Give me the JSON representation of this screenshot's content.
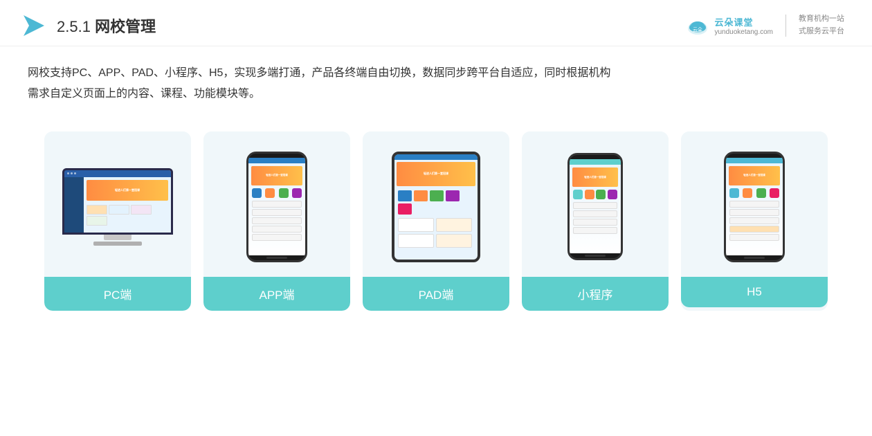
{
  "header": {
    "section_num": "2.5.1",
    "section_name": "网校管理",
    "brand_name": "云朵课堂",
    "brand_url": "yunduoketang.com",
    "brand_slogan_line1": "教育机构一站",
    "brand_slogan_line2": "式服务云平台"
  },
  "description": {
    "line1": "网校支持PC、APP、PAD、小程序、H5，实现多端打通，产品各终端自由切换，数据同步跨平台自适应，同时根据机构",
    "line2": "需求自定义页面上的内容、课程、功能模块等。"
  },
  "cards": [
    {
      "id": "pc",
      "label": "PC端"
    },
    {
      "id": "app",
      "label": "APP端"
    },
    {
      "id": "pad",
      "label": "PAD端"
    },
    {
      "id": "miniprogram",
      "label": "小程序"
    },
    {
      "id": "h5",
      "label": "H5"
    }
  ]
}
